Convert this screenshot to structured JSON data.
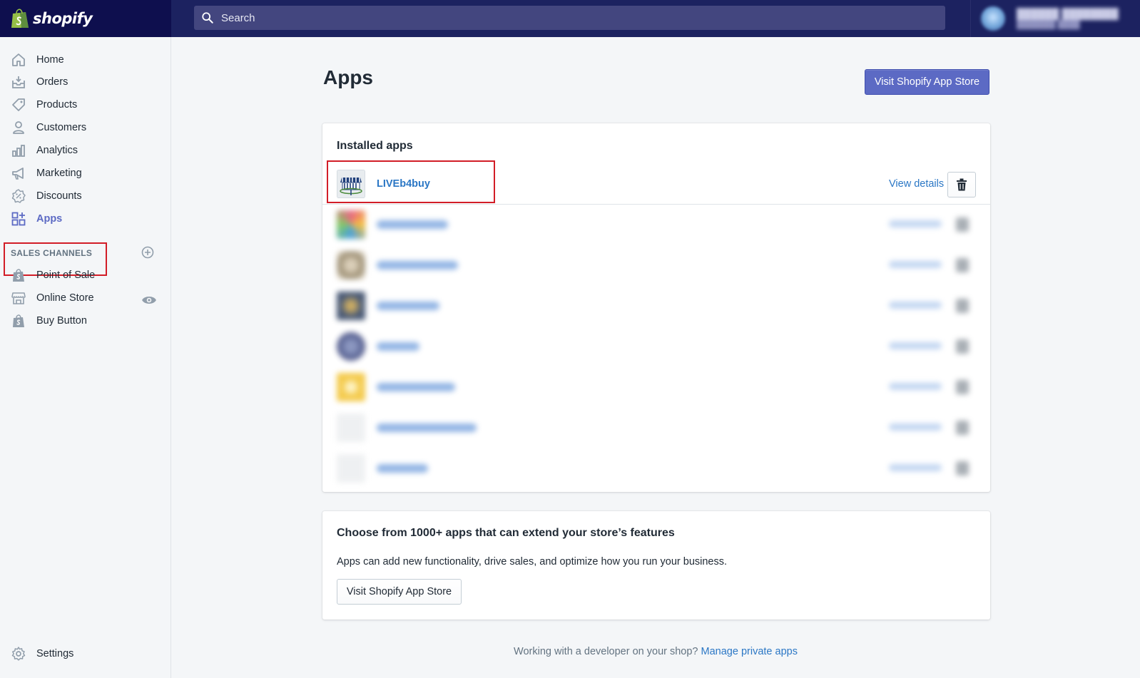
{
  "brand": {
    "logo_text": "shopify"
  },
  "search": {
    "placeholder": "Search"
  },
  "nav": {
    "items": [
      {
        "label": "Home",
        "icon": "home-icon"
      },
      {
        "label": "Orders",
        "icon": "orders-icon"
      },
      {
        "label": "Products",
        "icon": "tag-icon"
      },
      {
        "label": "Customers",
        "icon": "person-icon"
      },
      {
        "label": "Analytics",
        "icon": "bar-chart-icon"
      },
      {
        "label": "Marketing",
        "icon": "megaphone-icon"
      },
      {
        "label": "Discounts",
        "icon": "discount-icon"
      },
      {
        "label": "Apps",
        "icon": "apps-icon",
        "active": true
      }
    ],
    "sales_channels_title": "SALES CHANNELS",
    "channels": [
      {
        "label": "Point of Sale",
        "icon": "shopping-bag-icon"
      },
      {
        "label": "Online Store",
        "icon": "store-icon"
      },
      {
        "label": "Buy Button",
        "icon": "shopping-bag-icon"
      }
    ],
    "settings_label": "Settings"
  },
  "page": {
    "title": "Apps",
    "primary_action": "Visit Shopify App Store"
  },
  "installed": {
    "title": "Installed apps",
    "apps": [
      {
        "name": "LIVEb4buy",
        "action": "View details"
      }
    ],
    "view_details_label": "View details"
  },
  "promo": {
    "title": "Choose from 1000+ apps that can extend your store’s features",
    "text": "Apps can add new functionality, drive sales, and optimize how you run your business.",
    "button": "Visit Shopify App Store"
  },
  "footer": {
    "text": "Working with a developer on your shop?",
    "link": "Manage private apps"
  },
  "colors": {
    "topbar": "#1c2260",
    "accent": "#5c6ac4",
    "link": "#2b77c5",
    "highlight": "#d21d27"
  }
}
